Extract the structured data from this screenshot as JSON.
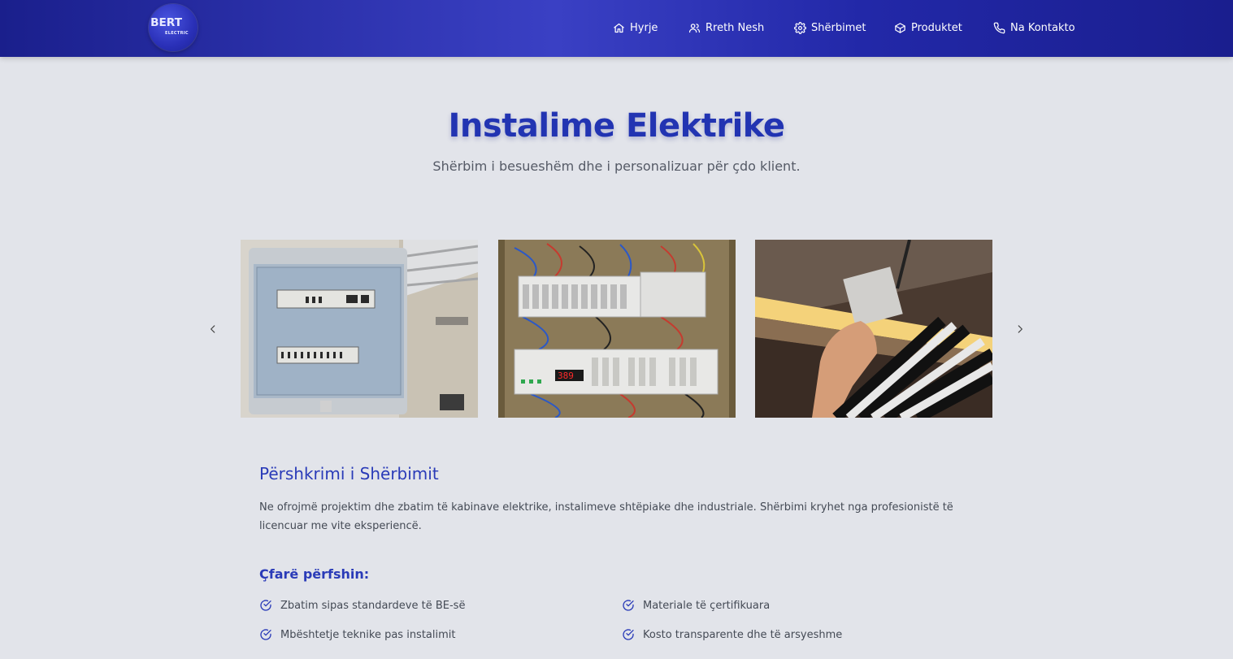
{
  "logo": {
    "text_main": "BERT",
    "text_sub": "ELECTRIC"
  },
  "nav": {
    "items": [
      {
        "label": "Hyrje",
        "icon": "home-icon"
      },
      {
        "label": "Rreth Nesh",
        "icon": "users-icon"
      },
      {
        "label": "Shërbimet",
        "icon": "gear-icon"
      },
      {
        "label": "Produktet",
        "icon": "box-icon"
      },
      {
        "label": "Na Kontakto",
        "icon": "phone-icon"
      }
    ]
  },
  "hero": {
    "title": "Instalime Elektrike",
    "subtitle": "Shërbim i besueshëm dhe i personalizuar për çdo klient."
  },
  "carousel": {
    "prev_icon": "chevron-left-icon",
    "next_icon": "chevron-right-icon",
    "slides": [
      {
        "subject": "electrical-panel-box-photo"
      },
      {
        "subject": "wired-distribution-board-photo",
        "display_value": "389"
      },
      {
        "subject": "technician-installing-ceiling-fixture-photo"
      }
    ]
  },
  "description": {
    "title": "Përshkrimi i Shërbimit",
    "text": "Ne ofrojmë projektim dhe zbatim të kabinave elektrike, instalimeve shtëpiake dhe industriale. Shërbimi kryhet nga profesionistë të licencuar me vite eksperiencë."
  },
  "includes": {
    "title": "Çfarë përfshin:",
    "icon": "check-circle-icon",
    "items": [
      "Zbatim sipas standardeve të BE-së",
      "Materiale të çertifikuara",
      "Mbështetje teknike pas instalimit",
      "Kosto transparente dhe të arsyeshme"
    ]
  },
  "colors": {
    "header_start": "#1a1f8c",
    "header_mid": "#3a40c4",
    "accent": "#2234b2",
    "background": "#e2e4ea"
  }
}
